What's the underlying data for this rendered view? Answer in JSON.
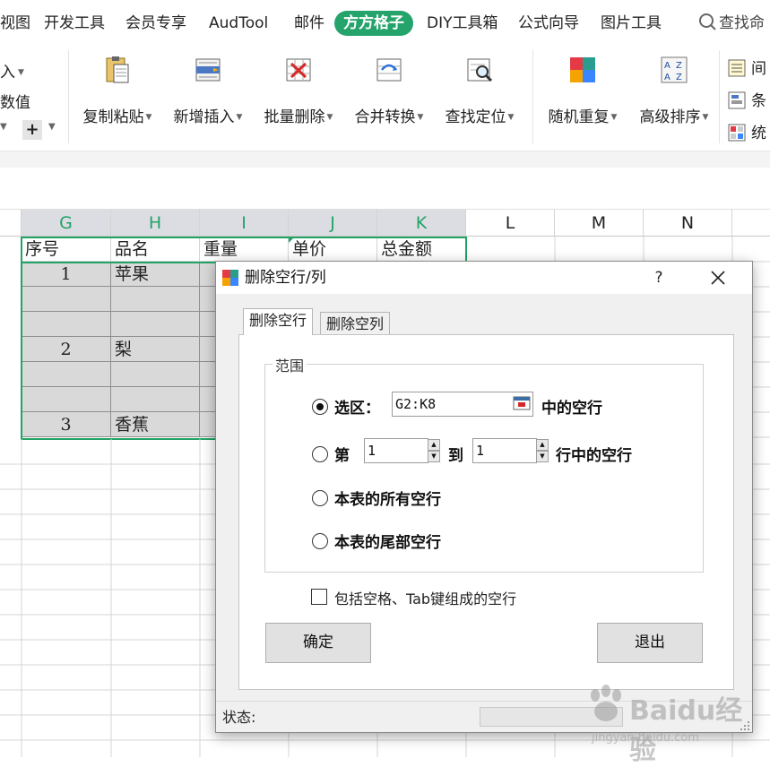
{
  "ribbon_tabs": [
    "视图",
    "开发工具",
    "会员专享",
    "AudTool",
    "邮件",
    "方方格子",
    "DIY工具箱",
    "公式向导",
    "图片工具"
  ],
  "active_tab": "方方格子",
  "search_text": "查找命",
  "ribbon_left_fragments": [
    "入",
    "数值"
  ],
  "ribbon_buttons": [
    {
      "label": "复制粘贴",
      "icon": "copy-paste-icon"
    },
    {
      "label": "新增插入",
      "icon": "insert-icon"
    },
    {
      "label": "批量删除",
      "icon": "batch-delete-icon"
    },
    {
      "label": "合并转换",
      "icon": "merge-convert-icon"
    },
    {
      "label": "查找定位",
      "icon": "find-locate-icon"
    },
    {
      "label": "随机重复",
      "icon": "random-repeat-icon"
    },
    {
      "label": "高级排序",
      "icon": "advanced-sort-icon"
    }
  ],
  "ribbon_small_buttons": [
    "间",
    "条",
    "统"
  ],
  "accent_color": "#24a46b",
  "sheet": {
    "columns": [
      "G",
      "H",
      "I",
      "J",
      "K",
      "L",
      "M",
      "N"
    ],
    "header_row": [
      "序号",
      "品名",
      "重量",
      "单价",
      "总金额"
    ],
    "rows": [
      {
        "seq": "1",
        "name": "苹果"
      },
      {
        "seq": "",
        "name": ""
      },
      {
        "seq": "",
        "name": ""
      },
      {
        "seq": "2",
        "name": "梨"
      },
      {
        "seq": "",
        "name": ""
      },
      {
        "seq": "",
        "name": ""
      },
      {
        "seq": "3",
        "name": "香蕉"
      }
    ]
  },
  "dialog": {
    "title": "删除空行/列",
    "help": "?",
    "tabs": [
      "删除空行",
      "删除空列"
    ],
    "group_label": "范围",
    "option_selection_label": "选区：",
    "selection_value": "G2:K8",
    "selection_suffix": "中的空行",
    "option_rows_prefix": "第",
    "row_from": "1",
    "row_to_label": "到",
    "row_to": "1",
    "rows_suffix": "行中的空行",
    "option_all": "本表的所有空行",
    "option_tail": "本表的尾部空行",
    "selected_option": "selection",
    "include_blank_label": "包括空格、Tab键组成的空行",
    "include_blank_checked": false,
    "ok_label": "确定",
    "exit_label": "退出",
    "status_label": "状态:"
  },
  "watermark": {
    "text": "Baidu经验",
    "sub": "jingyan.baidu.com"
  }
}
